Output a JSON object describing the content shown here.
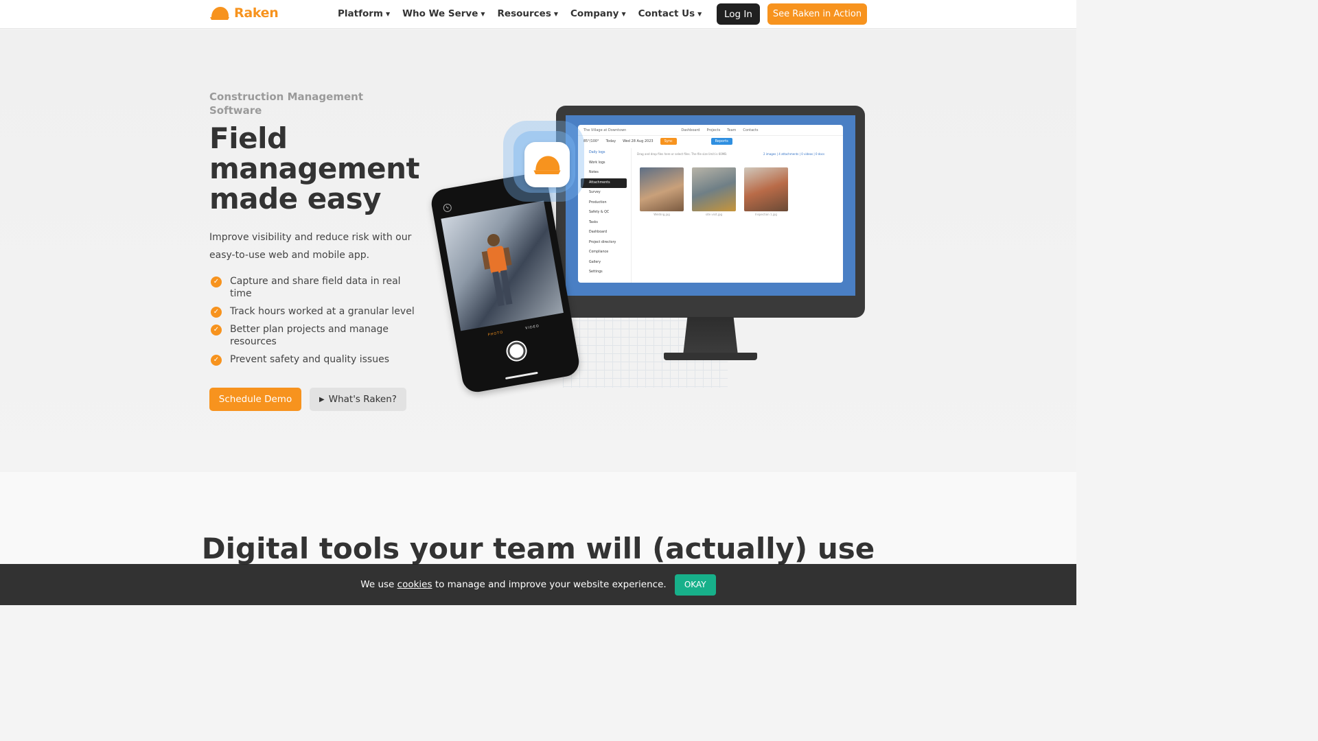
{
  "nav": {
    "brand": "Raken",
    "menu": [
      {
        "label": "Platform"
      },
      {
        "label": "Who We Serve"
      },
      {
        "label": "Resources"
      },
      {
        "label": "Company"
      },
      {
        "label": "Contact Us"
      }
    ],
    "login_label": "Log In",
    "cta_label": "See Raken in Action"
  },
  "hero": {
    "eyebrow": "Construction Management Software",
    "headline": "Field management made easy",
    "subtext": "Improve visibility and reduce risk with our easy-to-use web and mobile app.",
    "bullets": [
      "Capture and share field data in real time",
      "Track hours worked at a granular level",
      "Better plan projects and manage resources",
      "Prevent safety and quality issues"
    ],
    "demo_label": "Schedule Demo",
    "video_label": "What's Raken?"
  },
  "mockup": {
    "app_project": "The Village at Downtown",
    "app_nav": [
      "Dashboard",
      "Projects",
      "Team",
      "Contacts"
    ],
    "app_weather": "85°/100°",
    "app_today": "Today",
    "app_date": "Wed 28 Aug 2023",
    "app_sync": "Sync",
    "app_reports": "Reports",
    "app_drop": "Drag and drop files here or select files. The file size limit is 60MB.",
    "app_counts": "2 images | 4 attachments | 0 videos | 0 docs",
    "sidebar": [
      "Daily logs",
      "Work logs",
      "Notes",
      "Attachments",
      "Survey",
      "Production",
      "Safety & QC",
      "Tasks",
      "Dashboard",
      "Project directory",
      "Compliance",
      "Gallery",
      "Settings"
    ],
    "photo_captions": [
      "Welding.jpg",
      "site visit.jpg",
      "Inspection 1.jpg"
    ],
    "phone_mode_photo": "PHOTO",
    "phone_mode_video": "VIDEO"
  },
  "section2": {
    "title": "Digital tools your team will (actually) use"
  },
  "cookie": {
    "text_before": "We use",
    "link": "cookies",
    "text_after": "to manage and improve your website experience.",
    "button": "OKAY"
  },
  "colors": {
    "brand_orange": "#f7931e",
    "dark": "#202020",
    "cookie_green": "#17b08a",
    "screen_blue": "#4a7fc4"
  }
}
